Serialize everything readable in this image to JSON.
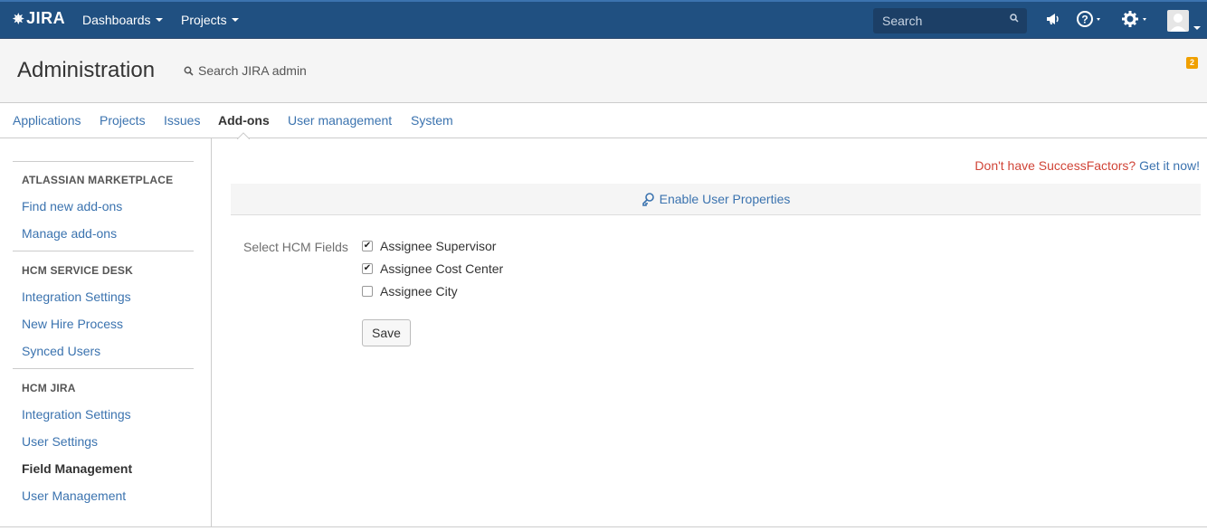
{
  "topbar": {
    "logo_text": "JIRA",
    "nav": [
      {
        "label": "Dashboards"
      },
      {
        "label": "Projects"
      }
    ],
    "search_placeholder": "Search",
    "icons": [
      "megaphone-icon",
      "help-icon",
      "settings-icon",
      "avatar-icon"
    ]
  },
  "admin": {
    "title": "Administration",
    "search_label": "Search JIRA admin",
    "notification_count": "2"
  },
  "tabs": [
    {
      "label": "Applications",
      "active": false
    },
    {
      "label": "Projects",
      "active": false
    },
    {
      "label": "Issues",
      "active": false
    },
    {
      "label": "Add-ons",
      "active": true
    },
    {
      "label": "User management",
      "active": false
    },
    {
      "label": "System",
      "active": false
    }
  ],
  "sidebar": {
    "sections": [
      {
        "heading": "ATLASSIAN MARKETPLACE",
        "links": [
          {
            "label": "Find new add-ons"
          },
          {
            "label": "Manage add-ons"
          }
        ]
      },
      {
        "heading": "HCM SERVICE DESK",
        "links": [
          {
            "label": "Integration Settings"
          },
          {
            "label": "New Hire Process"
          },
          {
            "label": "Synced Users"
          }
        ]
      },
      {
        "heading": "HCM JIRA",
        "links": [
          {
            "label": "Integration Settings"
          },
          {
            "label": "User Settings"
          },
          {
            "label": "Field Management",
            "current": true
          },
          {
            "label": "User Management"
          }
        ]
      }
    ]
  },
  "main": {
    "promo_question": "Don't have SuccessFactors?",
    "promo_link": "Get it now!",
    "enable_label": "Enable User Properties",
    "field_label": "Select HCM Fields",
    "checkboxes": [
      {
        "label": "Assignee Supervisor",
        "checked": true
      },
      {
        "label": "Assignee Cost Center",
        "checked": true
      },
      {
        "label": "Assignee City",
        "checked": false
      }
    ],
    "save_label": "Save"
  },
  "colors": {
    "topbar": "#205081",
    "link": "#3b73af",
    "promo_red": "#d04437"
  }
}
